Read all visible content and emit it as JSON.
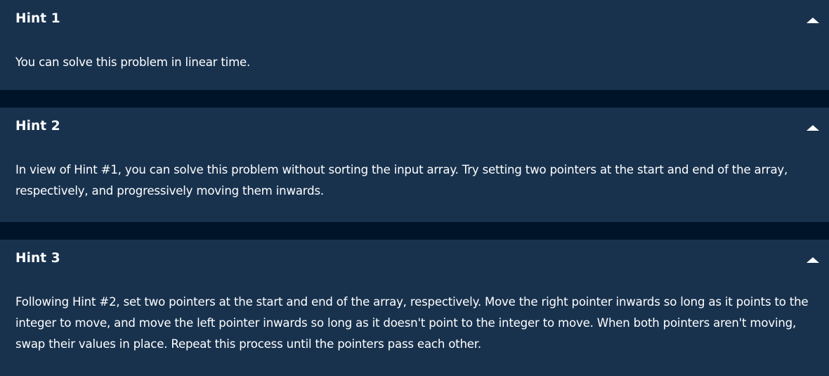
{
  "hints": [
    {
      "title": "Hint 1",
      "text": "You can solve this problem in linear time.",
      "toggle_icon": "caret-up-icon"
    },
    {
      "title": "Hint 2",
      "text": "In view of Hint #1, you can solve this problem without sorting the input array. Try setting two pointers at the start and end of the array, respectively, and progressively moving them inwards.",
      "toggle_icon": "caret-up-icon"
    },
    {
      "title": "Hint 3",
      "text": "Following Hint #2, set two pointers at the start and end of the array, respectively. Move the right pointer inwards so long as it points to the integer to move, and move the left pointer inwards so long as it doesn't point to the integer to move. When both pointers aren't moving, swap their values in place. Repeat this process until the pointers pass each other.",
      "toggle_icon": "caret-up-icon"
    }
  ],
  "colors": {
    "panel_background": "#18324e",
    "page_background": "#001429",
    "text": "#ffffff"
  }
}
